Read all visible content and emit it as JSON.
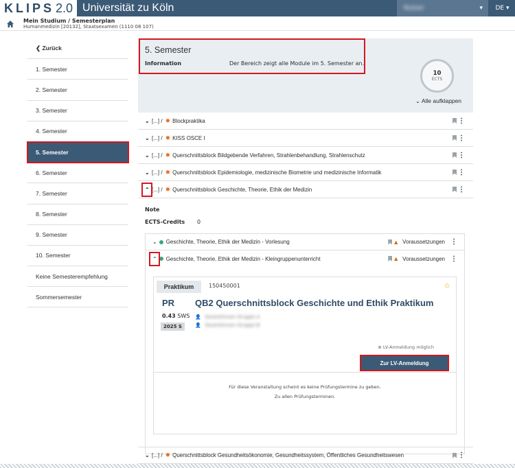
{
  "header": {
    "logo": "KLIPS",
    "logo_version": "2.0",
    "university": "Universität zu Köln",
    "user_blurred": "Nutzer",
    "lang": "DE ▾"
  },
  "breadcrumb": {
    "title": "Mein Studium / Semesterplan",
    "subtitle": "Humanmedizin [20132], Staatsexamen (1110 08 107)"
  },
  "sidebar": {
    "items": [
      {
        "label": "❮ Zurück"
      },
      {
        "label": "1. Semester"
      },
      {
        "label": "2. Semester"
      },
      {
        "label": "3. Semester"
      },
      {
        "label": "4. Semester"
      },
      {
        "label": "5. Semester"
      },
      {
        "label": "6. Semester"
      },
      {
        "label": "7. Semester"
      },
      {
        "label": "8. Semester"
      },
      {
        "label": "9. Semester"
      },
      {
        "label": "10. Semester"
      },
      {
        "label": "Keine Semesterempfehlung"
      },
      {
        "label": "Sommersemester"
      }
    ]
  },
  "main": {
    "title": "5. Semester",
    "info_label": "Information",
    "info_text": "Der Bereich zeigt alle Module im 5. Semester an.",
    "ects_value": "10",
    "ects_label": "ECTS",
    "expand_all": "Alle aufklappen",
    "modules": [
      {
        "prefix": "[...] /",
        "name": "Blockpraktika"
      },
      {
        "prefix": "[...] /",
        "name": "KISS OSCE I"
      },
      {
        "prefix": "[...] /",
        "name": "Querschnittsblock Bildgebende Verfahren, Strahlenbehandlung, Strahlenschutz"
      },
      {
        "prefix": "[...] /",
        "name": "Querschnittsblock Epidemiologie, medizinische Biometrie und medizinische Informatik"
      },
      {
        "prefix": "[...] /",
        "name": "Querschnittsblock Geschichte, Theorie, Ethik der Medizin"
      }
    ],
    "detail": {
      "note_label": "Note",
      "ects_label": "ECTS-Credits",
      "ects_value": "0",
      "sub": [
        {
          "name": "Geschichte, Theorie, Ethik der Medizin - Vorlesung",
          "req": "Voraussetzungen"
        },
        {
          "name": "Geschichte, Theorie, Ethik der Medizin - Kleingruppenunterricht",
          "req": "Voraussetzungen"
        }
      ],
      "course": {
        "type": "Praktikum",
        "number": "150450001",
        "short": "PR",
        "title": "QB2 Querschnittsblock Geschichte und Ethik Praktikum",
        "sws_value": "0.43",
        "sws_label": "SWS",
        "semester": "2025 S",
        "people1": "Dozentinnen Gruppe A",
        "people2": "Dozentinnen Gruppe B",
        "lv_note": "LV-Anmeldung möglich",
        "lv_button": "Zur LV-Anmeldung",
        "exam_text": "Für diese Veranstaltung scheint es keine Prüfungstermine zu geben.",
        "exam_link": "Zu allen Prüfungsterminen."
      }
    },
    "last_module": {
      "prefix": "[...] /",
      "name": "Querschnittsblock Gesundheitsökonomie, Gesundheitssystem, Öffentliches Gesundheitswesen"
    }
  }
}
